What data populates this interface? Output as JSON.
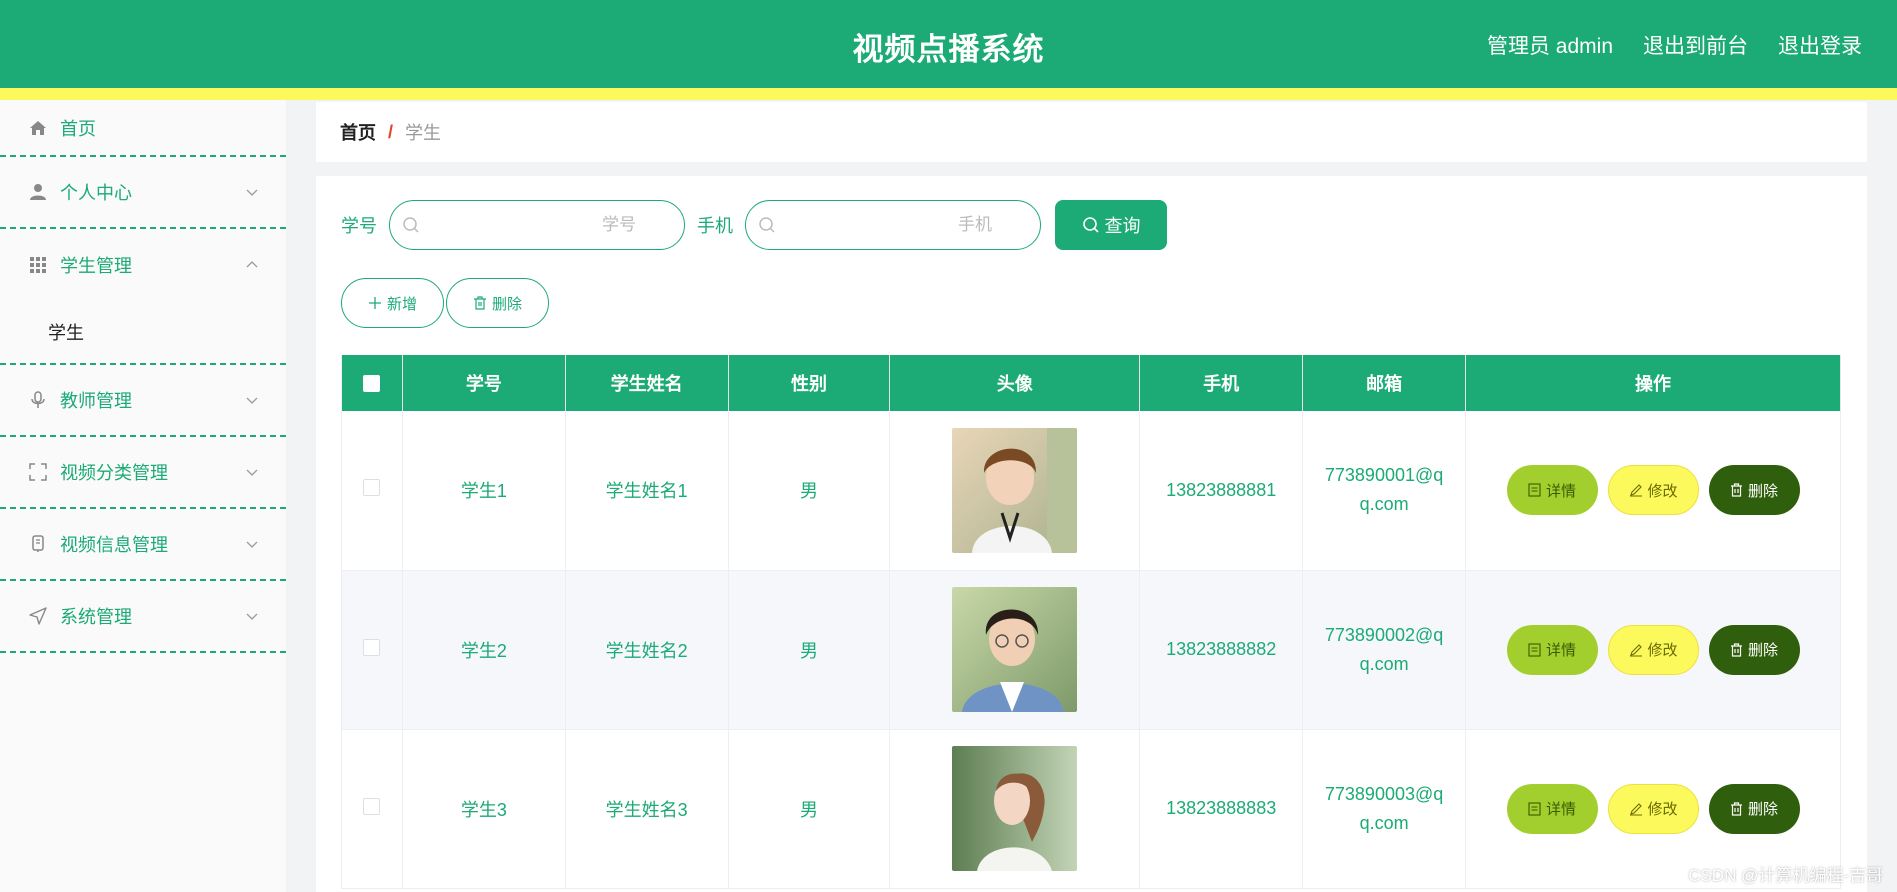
{
  "header": {
    "title": "视频点播系统",
    "links": [
      "管理员 admin",
      "退出到前台",
      "退出登录"
    ]
  },
  "sidebar": {
    "items": [
      {
        "label": "首页",
        "icon": "home-icon"
      },
      {
        "label": "个人中心",
        "icon": "user-icon",
        "arrow": "down"
      },
      {
        "label": "学生管理",
        "icon": "grid-icon",
        "arrow": "up"
      },
      {
        "label": "学生",
        "sub": true
      },
      {
        "label": "教师管理",
        "icon": "microphone-icon",
        "arrow": "down"
      },
      {
        "label": "视频分类管理",
        "icon": "fullscreen-icon",
        "arrow": "down"
      },
      {
        "label": "视频信息管理",
        "icon": "device-icon",
        "arrow": "down"
      },
      {
        "label": "系统管理",
        "icon": "send-icon",
        "arrow": "down"
      }
    ]
  },
  "breadcrumb": {
    "home": "首页",
    "separator": "/",
    "current": "学生"
  },
  "search": {
    "fields": [
      {
        "label": "学号",
        "placeholder": "学号"
      },
      {
        "label": "手机",
        "placeholder": "手机"
      }
    ],
    "query_label": "查询"
  },
  "actions": {
    "add_label": "新增",
    "delete_label": "删除"
  },
  "table": {
    "headers": [
      "学号",
      "学生姓名",
      "性别",
      "头像",
      "手机",
      "邮箱",
      "操作"
    ],
    "rows": [
      {
        "id": "学生1",
        "name": "学生姓名1",
        "gender": "男",
        "phone": "13823888881",
        "email_line1": "773890001@q",
        "email_line2": "q.com"
      },
      {
        "id": "学生2",
        "name": "学生姓名2",
        "gender": "男",
        "phone": "13823888882",
        "email_line1": "773890002@q",
        "email_line2": "q.com"
      },
      {
        "id": "学生3",
        "name": "学生姓名3",
        "gender": "男",
        "phone": "13823888883",
        "email_line1": "773890003@q",
        "email_line2": "q.com"
      }
    ],
    "ops": {
      "detail": "详情",
      "edit": "修改",
      "delete": "删除"
    }
  },
  "watermark": "CSDN @计算机编程-吉哥",
  "colors": {
    "primary": "#1caa76",
    "stripe": "#fbf95c",
    "detail": "#a2cf2e",
    "edit": "#fbf95c",
    "delete": "#2f5e0c"
  }
}
